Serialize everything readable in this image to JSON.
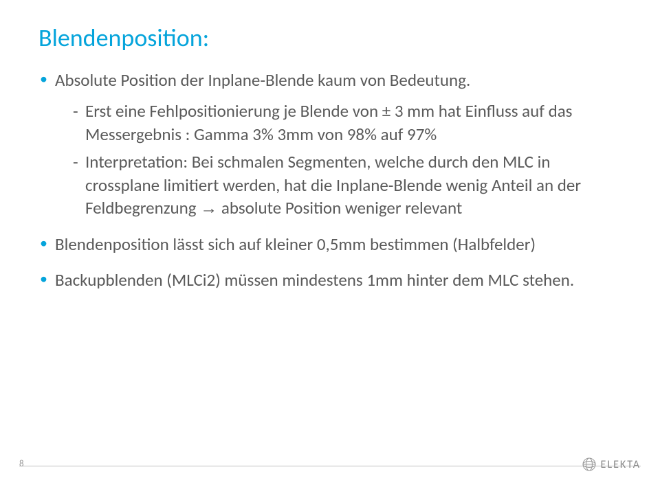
{
  "title": "Blendenposition:",
  "bullets": {
    "b1": "Absolute Position der Inplane-Blende kaum von Bedeutung.",
    "b1_sub1": "Erst eine Fehlpositionierung je Blende von ± 3 mm hat Einfluss auf das Messergebnis : Gamma 3% 3mm von 98% auf 97%",
    "b1_sub2_a": "Interpretation: Bei schmalen Segmenten, welche durch den MLC in crossplane limitiert werden, hat die Inplane-Blende wenig Anteil an der Feldbegrenzung ",
    "b1_sub2_arrow": "→",
    "b1_sub2_b": " absolute Position weniger relevant",
    "b2": "Blendenposition lässt sich auf kleiner 0,5mm bestimmen (Halbfelder)",
    "b3": "Backupblenden (MLCi2) müssen mindestens 1mm hinter dem MLC stehen."
  },
  "page_number": "8",
  "logo_text": "ELEKTA"
}
